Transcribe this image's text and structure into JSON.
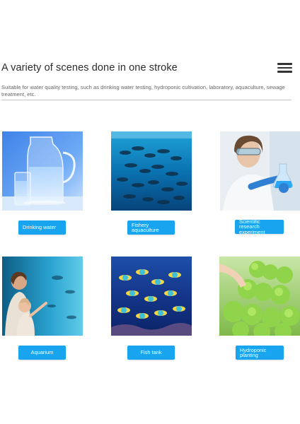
{
  "header": {
    "title": "A variety of scenes done in one stroke",
    "menu_icon": "hamburger-menu-icon"
  },
  "description": "Suitable for water quality testing, such as drinking water testing, hydroponic cultivation, laboratory, aquaculture, sewage treatment, etc.",
  "scenes": [
    {
      "label": "Drinking water",
      "image": "water-pitcher-glass-image"
    },
    {
      "label": "Fishery aquaculture",
      "image": "fish-school-underwater-image"
    },
    {
      "label": "Scientific research experiment",
      "image": "lab-scientist-image"
    },
    {
      "label": "Aquarium",
      "image": "aquarium-visitors-image"
    },
    {
      "label": "Fish tank",
      "image": "tropical-fish-tank-image"
    },
    {
      "label": "Hydroponic planting",
      "image": "hydroponic-lettuce-image"
    }
  ],
  "colors": {
    "accent": "#18a4ee",
    "title_text": "#2b2b2b",
    "desc_text": "#666666"
  }
}
